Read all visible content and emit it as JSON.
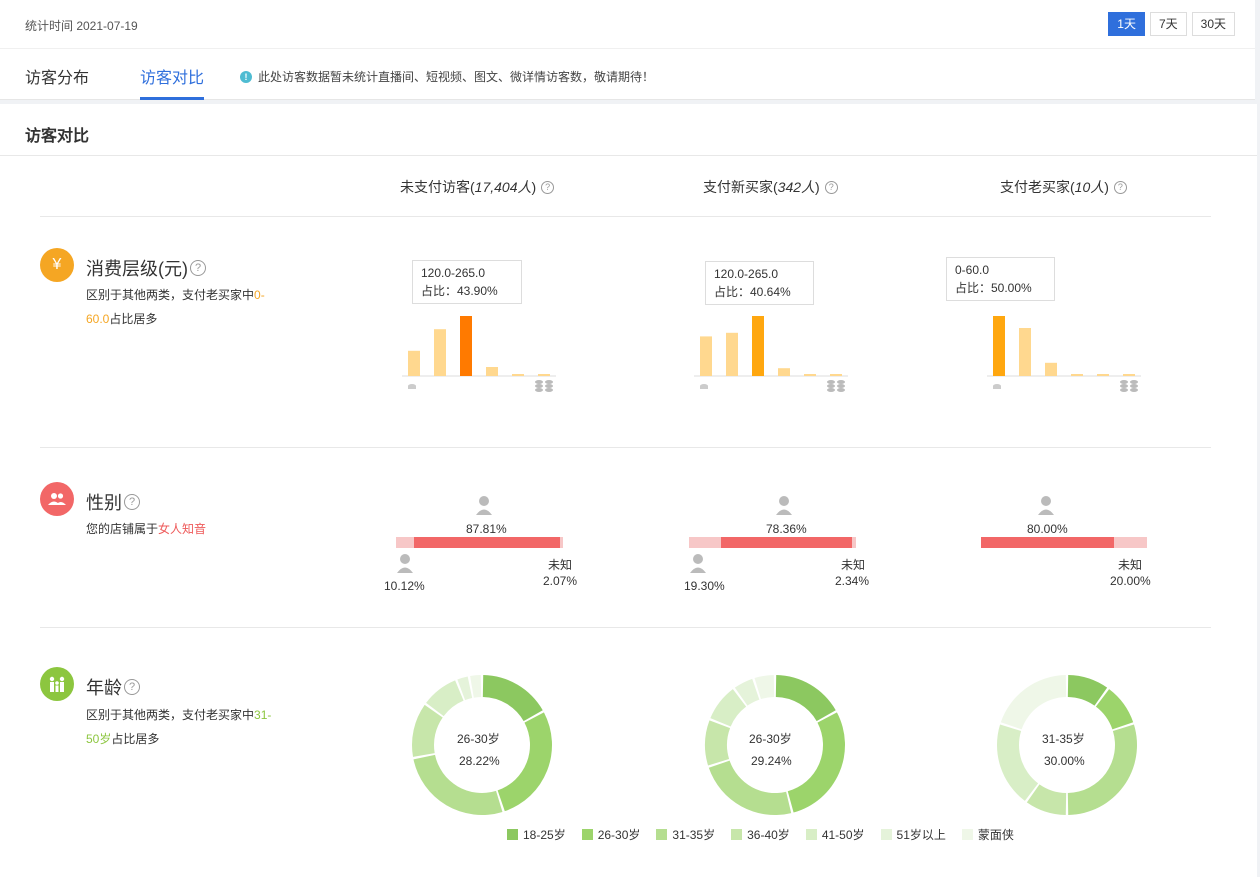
{
  "header": {
    "stat_time": "统计时间 2021-07-19",
    "ranges": [
      "1天",
      "7天",
      "30天"
    ],
    "active_range": "1天"
  },
  "tabs": {
    "items": [
      "访客分布",
      "访客对比"
    ],
    "active": "访客对比",
    "notice": "此处访客数据暂未统计直播间、短视频、图文、微详情访客数，敬请期待！"
  },
  "panel": {
    "title": "访客对比"
  },
  "columns": [
    {
      "label": "未支付访客(",
      "count": "17,404人",
      "close": ")"
    },
    {
      "label": "支付新买家(",
      "count": "342人",
      "close": ")"
    },
    {
      "label": "支付老买家(",
      "count": "10人",
      "close": ")"
    }
  ],
  "consumption": {
    "title": "消费层级(元)",
    "desc_prefix": "区别于其他两类，支付老买家中",
    "desc_highlight": "0-60.0",
    "desc_suffix": "占比居多",
    "icon": "yuan-icon",
    "charts": [
      {
        "tooltip_range": "120.0-265.0",
        "tooltip_share": "占比：43.90%",
        "values": [
          0.42,
          0.78,
          1.0,
          0.15,
          0.03,
          0.03
        ],
        "highlight": 2,
        "highlight_color": "#ff7a00"
      },
      {
        "tooltip_range": "120.0-265.0",
        "tooltip_share": "占比：40.64%",
        "values": [
          0.66,
          0.72,
          1.0,
          0.13,
          0.03,
          0.03
        ],
        "highlight": 2,
        "highlight_color": "#ffa70f"
      },
      {
        "tooltip_range": "0-60.0",
        "tooltip_share": "占比：50.00%",
        "values": [
          1.0,
          0.8,
          0.22,
          0.03,
          0.03,
          0.03
        ],
        "highlight": 0,
        "highlight_color": "#ffa70f"
      }
    ],
    "bar_color": "#ffd88f"
  },
  "gender": {
    "title": "性别",
    "desc_prefix": "您的店铺属于",
    "desc_highlight": "女人知音",
    "icon": "people-icon",
    "charts": [
      {
        "female": "87.81%",
        "male": "10.12%",
        "unknown_label": "未知",
        "unknown": "2.07%",
        "male_share": 0.1012,
        "female_share": 0.8781
      },
      {
        "female": "78.36%",
        "male": "19.30%",
        "unknown_label": "未知",
        "unknown": "2.34%",
        "male_share": 0.193,
        "female_share": 0.7836
      },
      {
        "female": "80.00%",
        "male": "",
        "unknown_label": "未知",
        "unknown": "20.00%",
        "male_share": 0.0,
        "female_share": 0.8
      }
    ]
  },
  "age": {
    "title": "年龄",
    "desc_prefix": "区别于其他两类，支付老买家中",
    "desc_highlight": "31-50岁",
    "desc_suffix": "占比居多",
    "icon": "family-icon",
    "charts": [
      {
        "center_label": "26-30岁",
        "center_value": "28.22%",
        "shares": [
          0.17,
          0.28,
          0.27,
          0.13,
          0.09,
          0.03,
          0.03
        ]
      },
      {
        "center_label": "26-30岁",
        "center_value": "29.24%",
        "shares": [
          0.17,
          0.29,
          0.24,
          0.11,
          0.09,
          0.05,
          0.05
        ]
      },
      {
        "center_label": "31-35岁",
        "center_value": "30.00%",
        "shares": [
          0.1,
          0.1,
          0.3,
          0.1,
          0.2,
          0.0,
          0.2
        ]
      }
    ],
    "legend": [
      {
        "label": "18-25岁",
        "color": "#8cc860"
      },
      {
        "label": "26-30岁",
        "color": "#9cd46b"
      },
      {
        "label": "31-35岁",
        "color": "#b5de90"
      },
      {
        "label": "36-40岁",
        "color": "#c7e6aa"
      },
      {
        "label": "41-50岁",
        "color": "#d8eec6"
      },
      {
        "label": "51岁以上",
        "color": "#e5f3da"
      },
      {
        "label": "蒙面侠",
        "color": "#eff7e8"
      }
    ]
  }
}
